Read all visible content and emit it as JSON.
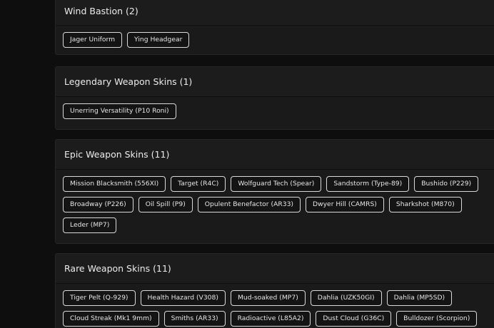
{
  "sections": [
    {
      "title": "Wind Bastion (2)",
      "items": [
        "Jager Uniform",
        "Ying Headgear"
      ]
    },
    {
      "title": "Legendary Weapon Skins (1)",
      "items": [
        "Unerring Versatility (P10 Roni)"
      ]
    },
    {
      "title": "Epic Weapon Skins (11)",
      "items": [
        "Mission Blacksmith (556XI)",
        "Target (R4C)",
        "Wolfguard Tech (Spear)",
        "Sandstorm (Type-89)",
        "Bushido (P229)",
        "Broadway (P226)",
        "Oil Spill (P9)",
        "Opulent Benefactor (AR33)",
        "Dwyer Hill (CAMRS)",
        "Sharkshot (M870)",
        "Leder (MP7)"
      ]
    },
    {
      "title": "Rare Weapon Skins (11)",
      "items": [
        "Tiger Pelt (Q-929)",
        "Health Hazard (V308)",
        "Mud-soaked (MP7)",
        "Dahlia (UZK50GI)",
        "Dahlia (MP5SD)",
        "Cloud Streak (Mk1 9mm)",
        "Smiths (AR33)",
        "Radioactive (L85A2)",
        "Dust Cloud (G36C)",
        "Bulldozer (Scorpion)"
      ]
    }
  ]
}
